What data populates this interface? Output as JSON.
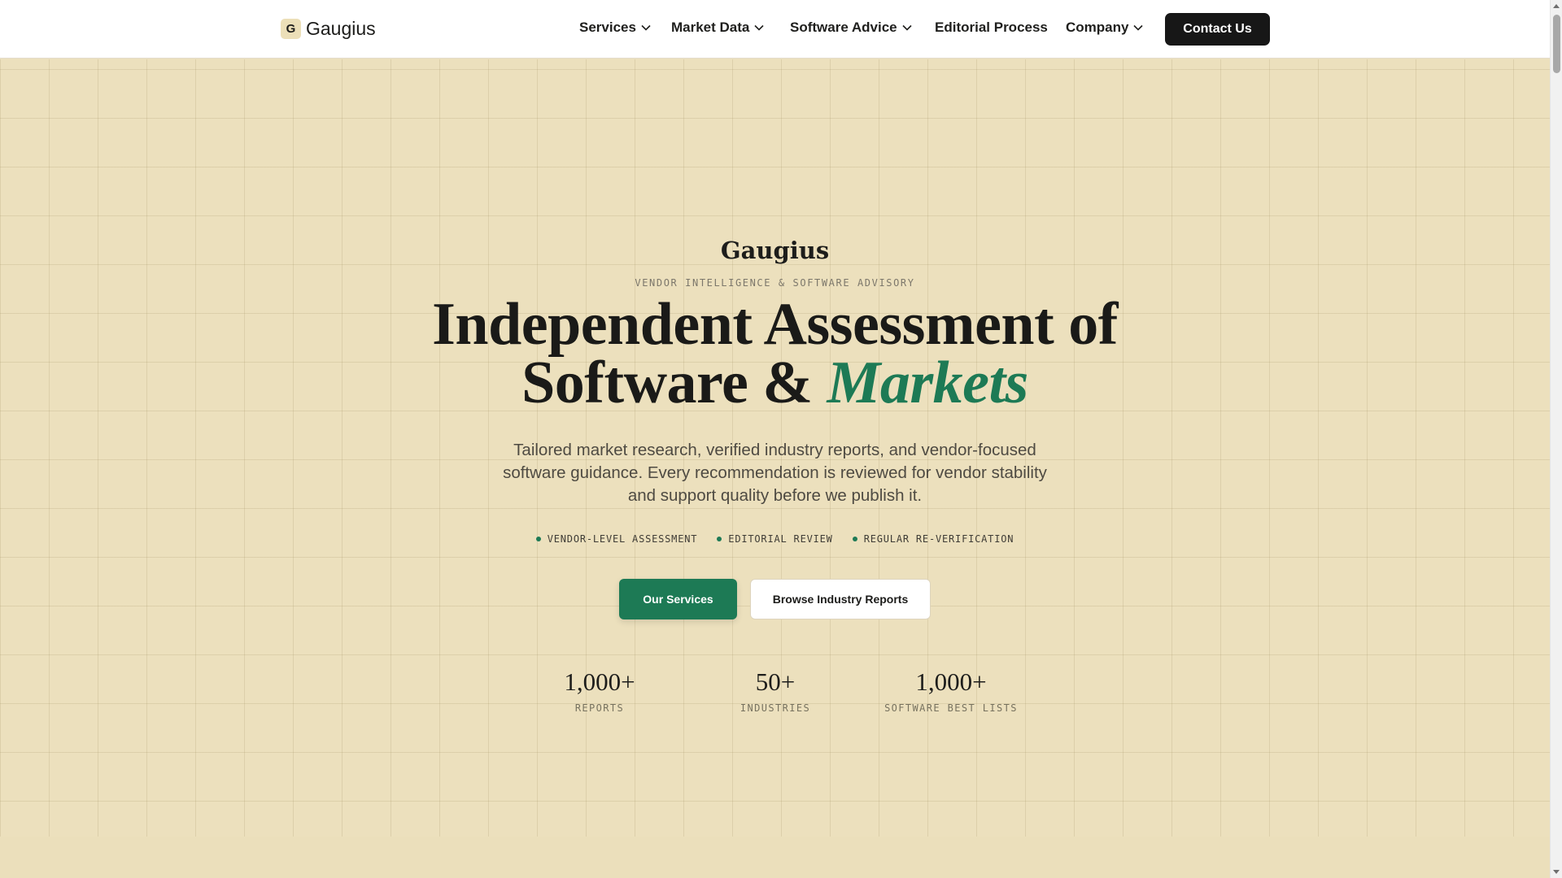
{
  "header": {
    "logo_letter": "G",
    "logo_text": "Gaugius",
    "nav": [
      {
        "label": "Services",
        "has_dropdown": true
      },
      {
        "label": "Market Data",
        "has_dropdown": true
      },
      {
        "label": "Software Advice",
        "has_dropdown": true
      },
      {
        "label": "Editorial Process",
        "has_dropdown": false
      },
      {
        "label": "Company",
        "has_dropdown": true
      }
    ],
    "contact_label": "Contact Us"
  },
  "hero": {
    "brand": "Gaugius",
    "eyebrow": "VENDOR INTELLIGENCE & SOFTWARE ADVISORY",
    "headline_line1": "Independent Assessment of",
    "headline_line2": "Software &",
    "headline_accent": "Markets",
    "subtext": "Tailored market research, verified industry reports, and vendor-focused software guidance. Every recommendation is reviewed for vendor stability and support quality before we publish it.",
    "tags": [
      "VENDOR-LEVEL ASSESSMENT",
      "EDITORIAL REVIEW",
      "REGULAR RE-VERIFICATION"
    ],
    "primary_button": "Our Services",
    "secondary_button": "Browse Industry Reports",
    "stats": [
      {
        "value": "1,000+",
        "label": "REPORTS"
      },
      {
        "value": "50+",
        "label": "INDUSTRIES"
      },
      {
        "value": "1,000+",
        "label": "SOFTWARE BEST LISTS"
      }
    ]
  },
  "colors": {
    "background": "#ece0bd",
    "accent_green": "#1d7a55",
    "dark_button": "#171717"
  },
  "icons": {
    "dropdown": "chevron-down-icon",
    "tag_bullet": "dot-icon"
  }
}
